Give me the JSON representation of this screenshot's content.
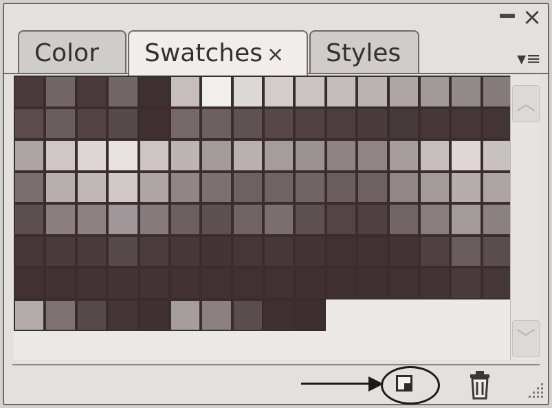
{
  "tabs": [
    {
      "label": "Color"
    },
    {
      "label": "Swatches",
      "close": "×"
    },
    {
      "label": "Styles"
    }
  ],
  "title_controls": {
    "minimize": "—",
    "close": "×"
  },
  "menu_icon": "▾≡",
  "scroll": {
    "up": "︿",
    "down": "﹀"
  },
  "colors": {
    "panel_bg": "#e3e1de",
    "border": "#6e6c6a",
    "swatch_border": "#3b2d2e"
  },
  "swatch_rows": [
    [
      "#4a3a3b",
      "#726667",
      "#4a3a3b",
      "#726667",
      "#3e2f30",
      "#c6bebe",
      "#f1eeee",
      "#ddd8d8",
      "#d2cccc",
      "#cbc4c4",
      "#c4bdbd",
      "#bab3b3",
      "#aea6a6",
      "#a29999",
      "#938a8a",
      "#857b7b"
    ],
    [
      "#5a4c4d",
      "#6a5d5e",
      "#524445",
      "#574a4b",
      "#3f3031",
      "#746869",
      "#6c6061",
      "#5f5253",
      "#564849",
      "#504243",
      "#4c3e3f",
      "#4a3c3d",
      "#473a3b",
      "#463839",
      "#453738",
      "#443637"
    ],
    [
      "#aca3a3",
      "#cec7c7",
      "#dcd6d6",
      "#e8e3e3",
      "#ccc5c5",
      "#bdb5b5",
      "#a39a9a",
      "#b9b0b0",
      "#a59c9c",
      "#9b9292",
      "#8e8484",
      "#8f8585",
      "#a69e9e",
      "#c5bebe",
      "#ddd7d7",
      "#c8c1c1"
    ],
    [
      "#7a6e6f",
      "#b7afaf",
      "#bfb8b8",
      "#cfc9c9",
      "#aea6a6",
      "#908687",
      "#7c7172",
      "#6d6162",
      "#6f6364",
      "#706465",
      "#6a5e5f",
      "#6d6162",
      "#918788",
      "#a39b9b",
      "#b6aeae",
      "#aca4a4"
    ],
    [
      "#5c4f50",
      "#8a7f80",
      "#8d8283",
      "#a0979a",
      "#877c7d",
      "#6c6061",
      "#5e5152",
      "#706465",
      "#7a6f70",
      "#5d5051",
      "#534546",
      "#4f4142",
      "#716566",
      "#887e7f",
      "#a39b9b",
      "#8b8182"
    ],
    [
      "#463839",
      "#4a3c3d",
      "#4a3c3d",
      "#574a4b",
      "#4b3d3e",
      "#463839",
      "#433536",
      "#453738",
      "#463839",
      "#433536",
      "#403233",
      "#403233",
      "#433536",
      "#4f4142",
      "#685c5d",
      "#5a4d4e"
    ],
    [
      "#403233",
      "#413334",
      "#423435",
      "#433536",
      "#423435",
      "#413334",
      "#403233",
      "#403233",
      "#403233",
      "#3f3132",
      "#3f3132",
      "#3f3132",
      "#403233",
      "#423435",
      "#4a3c3d",
      "#463839"
    ],
    [
      "#b4acac",
      "#7e7374",
      "#574a4b",
      "#443637",
      "#3f3132",
      "#a69e9e",
      "#8b8182",
      "#5a4d4e",
      "#3f3132",
      "#3d2f30",
      "",
      "",
      "",
      "",
      "",
      ""
    ]
  ]
}
